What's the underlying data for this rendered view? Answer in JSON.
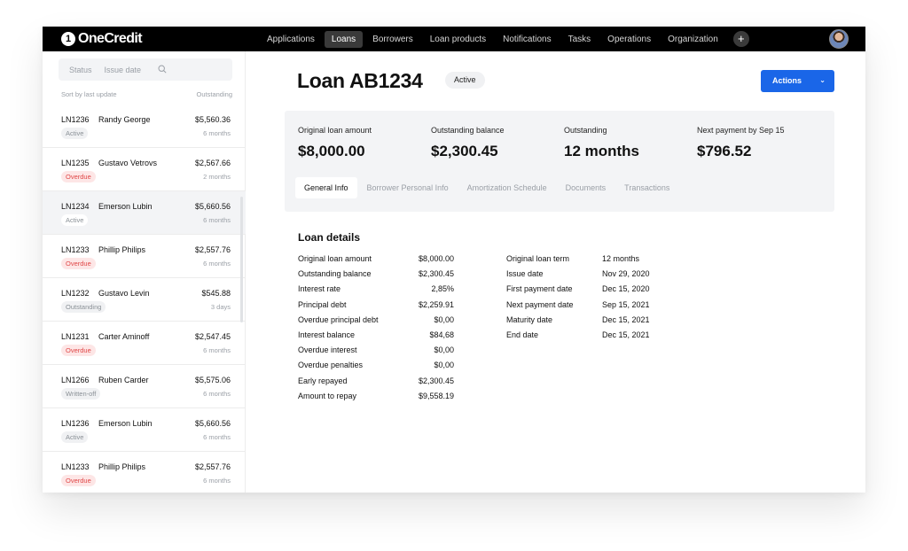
{
  "app": {
    "logo_mark": "1",
    "logo_text": "OneCredit"
  },
  "nav": {
    "items": [
      "Applications",
      "Loans",
      "Borrowers",
      "Loan products",
      "Notifications",
      "Tasks",
      "Operations",
      "Organization"
    ],
    "active": "Loans",
    "plus_label": "+"
  },
  "sidebar": {
    "filters": [
      "Status",
      "Issue date"
    ],
    "sort_label": "Sort by last update",
    "sort_column": "Outstanding",
    "items": [
      {
        "id": "LN1236",
        "name": "Randy George",
        "amount": "$5,560.36",
        "status": "Active",
        "time": "6 months"
      },
      {
        "id": "LN1235",
        "name": "Gustavo Vetrovs",
        "amount": "$2,567.66",
        "status": "Overdue",
        "time": "2 months"
      },
      {
        "id": "LN1234",
        "name": "Emerson Lubin",
        "amount": "$5,660.56",
        "status": "Active",
        "time": "6 months"
      },
      {
        "id": "LN1233",
        "name": "Phillip Philips",
        "amount": "$2,557.76",
        "status": "Overdue",
        "time": "6 months"
      },
      {
        "id": "LN1232",
        "name": "Gustavo Levin",
        "amount": "$545.88",
        "status": "Outstanding",
        "time": "3 days"
      },
      {
        "id": "LN1231",
        "name": "Carter Aminoff",
        "amount": "$2,547.45",
        "status": "Overdue",
        "time": "6 months"
      },
      {
        "id": "LN1266",
        "name": "Ruben Carder",
        "amount": "$5,575.06",
        "status": "Written-off",
        "time": "6 months"
      },
      {
        "id": "LN1236",
        "name": "Emerson Lubin",
        "amount": "$5,660.56",
        "status": "Active",
        "time": "6 months"
      },
      {
        "id": "LN1233",
        "name": "Phillip Philips",
        "amount": "$2,557.76",
        "status": "Overdue",
        "time": "6 months"
      }
    ]
  },
  "loan": {
    "title": "Loan AB1234",
    "status": "Active",
    "actions_label": "Actions"
  },
  "summary": [
    {
      "label": "Original loan amount",
      "value": "$8,000.00"
    },
    {
      "label": "Outstanding balance",
      "value": "$2,300.45"
    },
    {
      "label": "Outstanding",
      "value": "12 months"
    },
    {
      "label": "Next payment by Sep 15",
      "value": "$796.52"
    }
  ],
  "tabs": [
    "General Info",
    "Borrower Personal Info",
    "Amortization Schedule",
    "Documents",
    "Transactions"
  ],
  "details": {
    "title": "Loan details",
    "left": [
      {
        "label": "Original loan amount",
        "value": "$8,000.00"
      },
      {
        "label": "Outstanding balance",
        "value": "$2,300.45"
      },
      {
        "label": "Interest rate",
        "value": "2,85%"
      },
      {
        "label": "Principal debt",
        "value": "$2,259.91"
      },
      {
        "label": "Overdue principal debt",
        "value": "$0,00"
      },
      {
        "label": "Interest balance",
        "value": "$84,68"
      },
      {
        "label": "Overdue interest",
        "value": "$0,00"
      },
      {
        "label": "Overdue penalties",
        "value": "$0,00"
      },
      {
        "label": "Early repayed",
        "value": "$2,300.45"
      },
      {
        "label": "Amount to repay",
        "value": "$9,558.19"
      }
    ],
    "right": [
      {
        "label": "Original loan term",
        "value": "12 months"
      },
      {
        "label": "Issue date",
        "value": "Nov 29, 2020"
      },
      {
        "label": "First payment date",
        "value": "Dec 15, 2020"
      },
      {
        "label": "Next payment date",
        "value": "Sep 15, 2021"
      },
      {
        "label": "Maturity date",
        "value": "Dec 15, 2021"
      },
      {
        "label": "End date",
        "value": "Dec 15, 2021"
      }
    ]
  },
  "colors": {
    "accent": "#1a66e8",
    "overdue": "#e04848",
    "panel": "#f3f4f6",
    "topbar": "#000000"
  },
  "icons": {
    "search": "search-icon",
    "actions_chevron": "chevron-down-icon",
    "add": "plus-icon"
  }
}
